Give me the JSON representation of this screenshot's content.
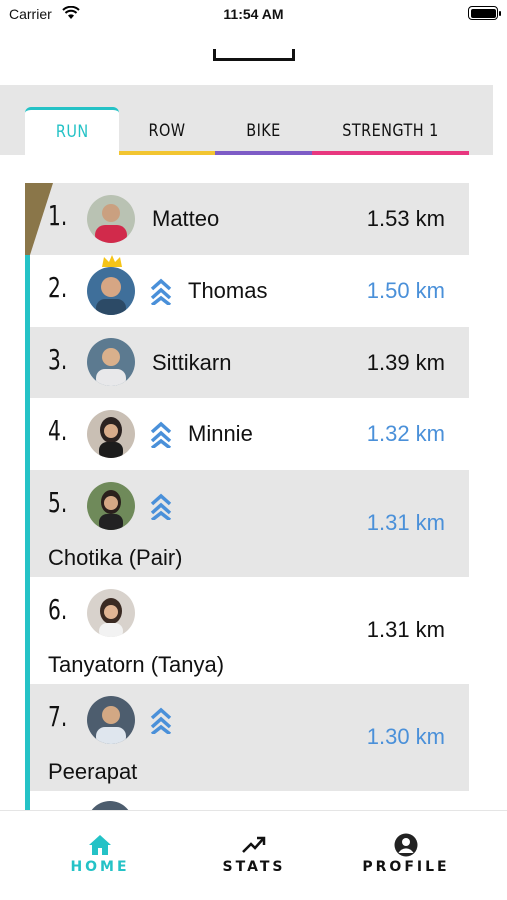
{
  "status_bar": {
    "carrier": "Carrier",
    "time": "11:54 AM"
  },
  "tabs": [
    {
      "label": "RUN",
      "color": "#24c2c6",
      "active": true
    },
    {
      "label": "ROW",
      "color": "#f2c531"
    },
    {
      "label": "BIKE",
      "color": "#7d5cc6"
    },
    {
      "label": "STRENGTH 1",
      "color": "#e8377f"
    }
  ],
  "leaderboard": [
    {
      "rank": "1.",
      "name": "Matteo",
      "distance": "1.53 km",
      "highlight": false,
      "boost_icon": "chevron-double-up-icon"
    },
    {
      "rank": "2.",
      "name": "Thomas",
      "distance": "1.50 km",
      "highlight": true,
      "crown_icon": "crown-icon",
      "boost_icon": "chevron-double-up-icon"
    },
    {
      "rank": "3.",
      "name": "Sittikarn",
      "distance": "1.39 km",
      "highlight": false
    },
    {
      "rank": "4.",
      "name": "Minnie",
      "distance": "1.32 km",
      "highlight": true,
      "boost_icon": "chevron-double-up-icon"
    },
    {
      "rank": "5.",
      "name": "Chotika (Pair)",
      "distance": "1.31 km",
      "highlight": true,
      "boost_icon": "chevron-double-up-icon"
    },
    {
      "rank": "6.",
      "name": "Tanyatorn (Tanya)",
      "distance": "1.31 km",
      "highlight": false
    },
    {
      "rank": "7.",
      "name": "Peerapat",
      "distance": "1.30 km",
      "highlight": true,
      "boost_icon": "chevron-double-up-icon"
    }
  ],
  "bottom_nav": [
    {
      "label": "HOME",
      "icon": "home-icon",
      "active": true,
      "color": "#24c2c6"
    },
    {
      "label": "STATS",
      "icon": "trending-up-icon",
      "active": false
    },
    {
      "label": "PROFILE",
      "icon": "user-icon",
      "active": false
    }
  ],
  "colors": {
    "accent": "#24c2c6",
    "highlight_blue": "#4a90d9",
    "row_gray": "#e6e6e6"
  }
}
